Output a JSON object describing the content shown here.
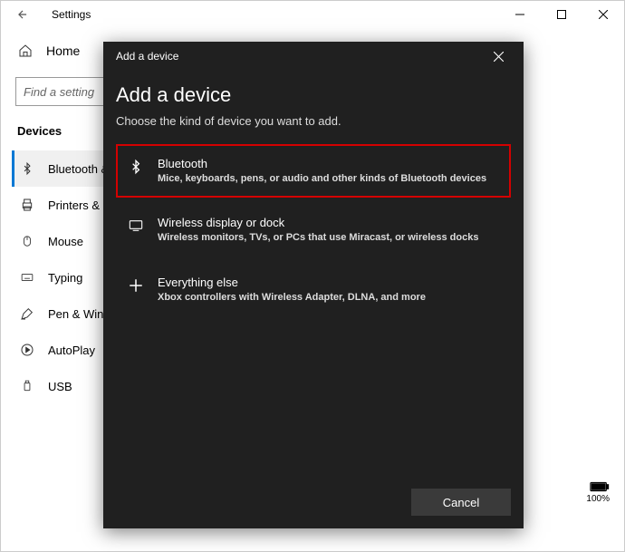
{
  "window": {
    "title": "Settings",
    "sys": {
      "min": "—",
      "max": "▢",
      "close": "✕"
    }
  },
  "home_label": "Home",
  "search": {
    "placeholder": "Find a setting"
  },
  "section_header": "Devices",
  "sidebar": {
    "items": [
      {
        "label": "Bluetooth & other devices",
        "icon": "bluetooth"
      },
      {
        "label": "Printers & scanners",
        "icon": "printer"
      },
      {
        "label": "Mouse",
        "icon": "mouse"
      },
      {
        "label": "Typing",
        "icon": "keyboard"
      },
      {
        "label": "Pen & Windows Ink",
        "icon": "pen"
      },
      {
        "label": "AutoPlay",
        "icon": "autoplay"
      },
      {
        "label": "USB",
        "icon": "usb"
      }
    ]
  },
  "systray": {
    "battery_pct": "100%"
  },
  "modal": {
    "titlebar": "Add a device",
    "heading": "Add a device",
    "subtitle": "Choose the kind of device you want to add.",
    "options": [
      {
        "title": "Bluetooth",
        "desc": "Mice, keyboards, pens, or audio and other kinds of Bluetooth devices",
        "icon": "bluetooth",
        "highlighted": true
      },
      {
        "title": "Wireless display or dock",
        "desc": "Wireless monitors, TVs, or PCs that use Miracast, or wireless docks",
        "icon": "display",
        "highlighted": false
      },
      {
        "title": "Everything else",
        "desc": "Xbox controllers with Wireless Adapter, DLNA, and more",
        "icon": "plus",
        "highlighted": false
      }
    ],
    "cancel_label": "Cancel"
  }
}
